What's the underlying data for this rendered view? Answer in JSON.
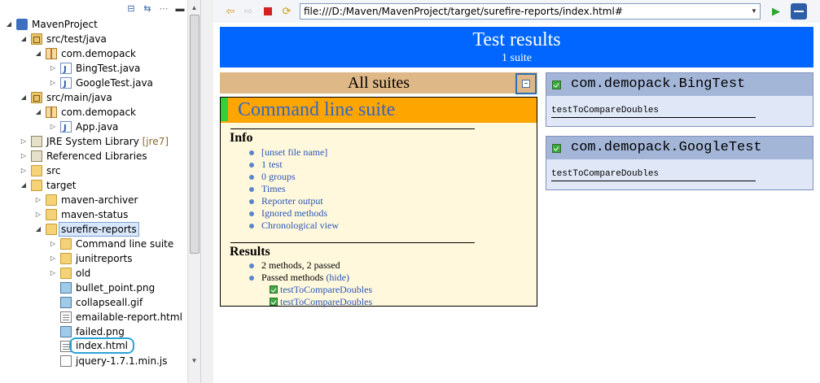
{
  "explorer": {
    "tree": [
      {
        "label": "MavenProject",
        "depth": 0,
        "expanded": true,
        "icon": "project-icon"
      },
      {
        "label": "src/test/java",
        "depth": 1,
        "expanded": true,
        "icon": "source-folder-icon"
      },
      {
        "label": "com.demopack",
        "depth": 2,
        "expanded": true,
        "icon": "package-icon"
      },
      {
        "label": "BingTest.java",
        "depth": 3,
        "expanded": false,
        "icon": "java-file-icon"
      },
      {
        "label": "GoogleTest.java",
        "depth": 3,
        "expanded": false,
        "icon": "java-file-icon"
      },
      {
        "label": "src/main/java",
        "depth": 1,
        "expanded": true,
        "icon": "source-folder-icon"
      },
      {
        "label": "com.demopack",
        "depth": 2,
        "expanded": true,
        "icon": "package-icon"
      },
      {
        "label": "App.java",
        "depth": 3,
        "expanded": false,
        "icon": "java-file-icon"
      },
      {
        "label": "JRE System Library",
        "decoration": "[jre7]",
        "depth": 1,
        "expanded": false,
        "icon": "library-icon"
      },
      {
        "label": "Referenced Libraries",
        "depth": 1,
        "expanded": false,
        "icon": "library-icon"
      },
      {
        "label": "src",
        "depth": 1,
        "expanded": false,
        "icon": "folder-icon"
      },
      {
        "label": "target",
        "depth": 1,
        "expanded": true,
        "icon": "folder-icon"
      },
      {
        "label": "maven-archiver",
        "depth": 2,
        "expanded": false,
        "icon": "folder-icon"
      },
      {
        "label": "maven-status",
        "depth": 2,
        "expanded": false,
        "icon": "folder-icon"
      },
      {
        "label": "surefire-reports",
        "depth": 2,
        "expanded": true,
        "icon": "folder-icon",
        "selected": true
      },
      {
        "label": "Command line suite",
        "depth": 3,
        "expanded": false,
        "icon": "folder-icon"
      },
      {
        "label": "junitreports",
        "depth": 3,
        "expanded": false,
        "icon": "folder-icon"
      },
      {
        "label": "old",
        "depth": 3,
        "expanded": false,
        "icon": "folder-icon"
      },
      {
        "label": "bullet_point.png",
        "depth": 3,
        "icon": "image-file-icon"
      },
      {
        "label": "collapseall.gif",
        "depth": 3,
        "icon": "image-file-icon"
      },
      {
        "label": "emailable-report.html",
        "depth": 3,
        "icon": "html-file-icon"
      },
      {
        "label": "failed.png",
        "depth": 3,
        "icon": "image-file-icon"
      },
      {
        "label": "index.html",
        "depth": 3,
        "icon": "html-file-icon",
        "circled": true
      },
      {
        "label": "jquery-1.7.1.min.js",
        "depth": 3,
        "icon": "js-file-icon"
      }
    ]
  },
  "browser": {
    "url": "file:///D:/Maven/MavenProject/target/surefire-reports/index.html#"
  },
  "report": {
    "title": "Test results",
    "subtitle": "1 suite",
    "suites_header": "All suites",
    "suite_name": "Command line suite",
    "info_heading": "Info",
    "info_links": [
      "[unset file name]",
      "1 test",
      "0 groups",
      "Times",
      "Reporter output",
      "Ignored methods",
      "Chronological view"
    ],
    "results_heading": "Results",
    "results_summary": "2 methods, 2 passed",
    "passed_label": "Passed methods",
    "hide_link": "(hide)",
    "passed_methods": [
      "testToCompareDoubles",
      "testToCompareDoubles"
    ],
    "classes": [
      {
        "name": "com.demopack.BingTest",
        "method": "testToCompareDoubles"
      },
      {
        "name": "com.demopack.GoogleTest",
        "method": "testToCompareDoubles"
      }
    ]
  },
  "colors": {
    "banner": "#0066ff",
    "suites_header": "#deb887",
    "suite_title_bar": "#ffa500",
    "suite_body": "#fff8dc",
    "class_header": "#a4b6d8",
    "class_body": "#e0e8f8",
    "passed": "#34d039"
  }
}
